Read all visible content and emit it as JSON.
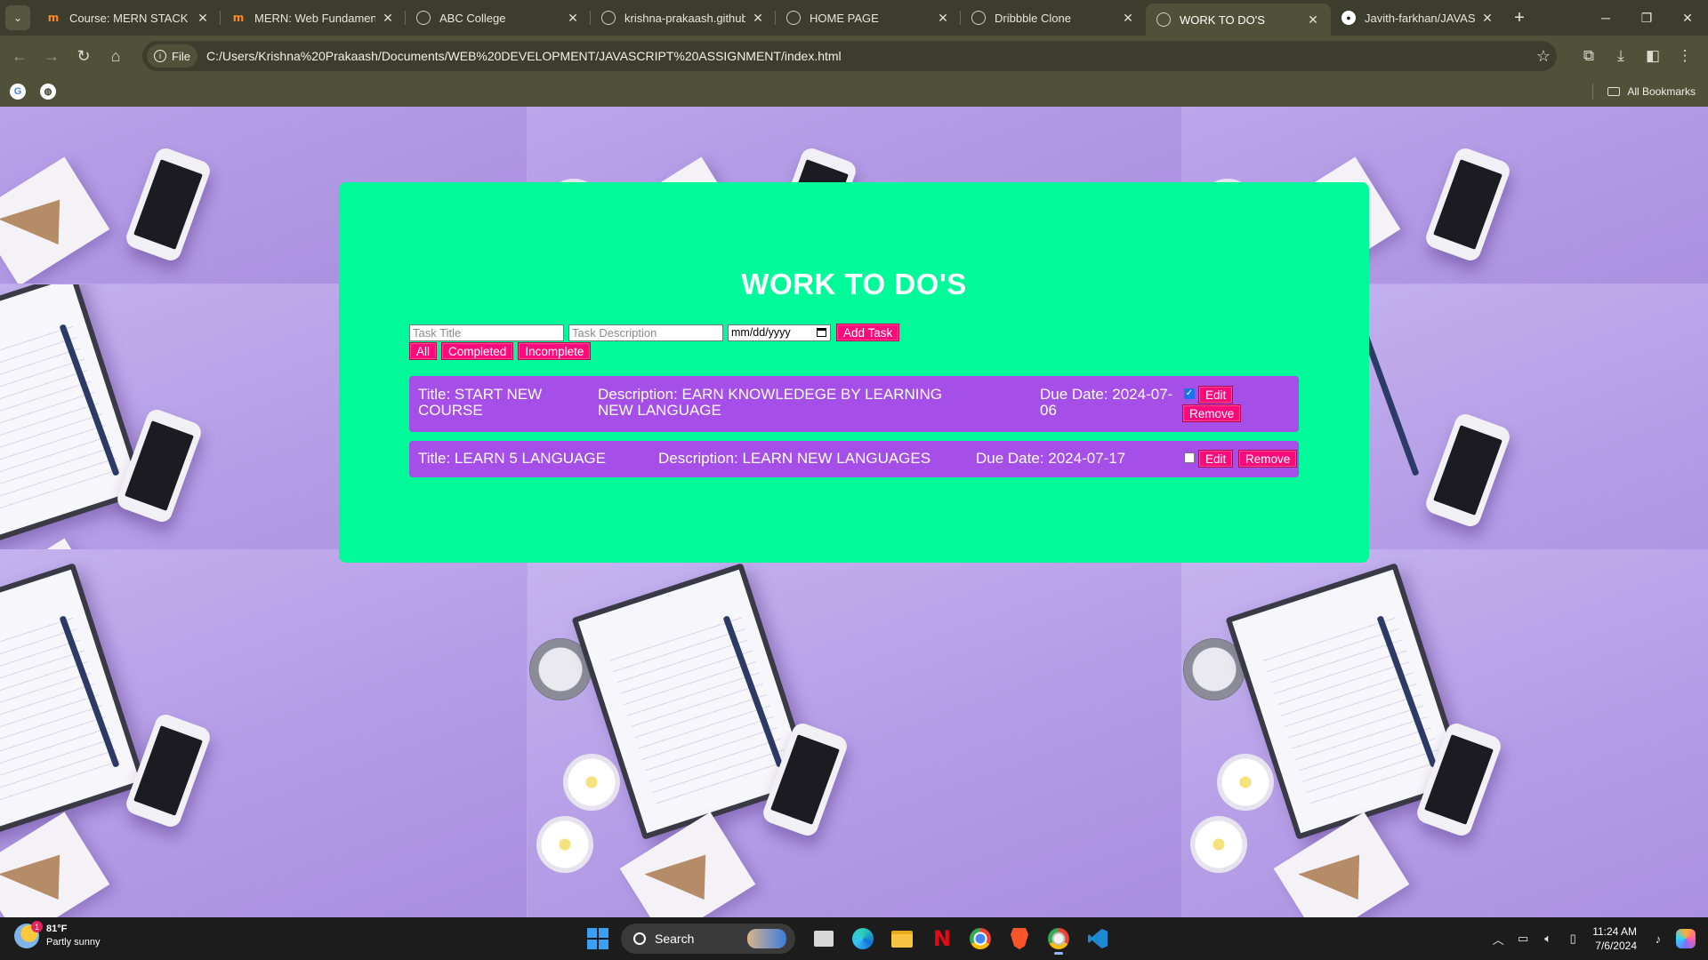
{
  "browser": {
    "tabs": [
      {
        "label": "Course: MERN STACK | SE",
        "favicon": "m-logo-icon",
        "active": false
      },
      {
        "label": "MERN: Web Fundamentals",
        "favicon": "m-logo-icon",
        "active": false
      },
      {
        "label": "ABC College",
        "favicon": "globe-icon",
        "active": false
      },
      {
        "label": "krishna-prakaash.github.io",
        "favicon": "globe-icon",
        "active": false
      },
      {
        "label": "HOME PAGE",
        "favicon": "globe-icon",
        "active": false
      },
      {
        "label": "Dribbble Clone",
        "favicon": "globe-icon",
        "active": false
      },
      {
        "label": "WORK TO DO'S",
        "favicon": "globe-icon",
        "active": true
      },
      {
        "label": "Javith-farkhan/JAVASCRIPT",
        "favicon": "github-icon",
        "active": false
      }
    ],
    "new_tab_label": "+",
    "address": {
      "scheme_chip": "File",
      "url": "C:/Users/Krishna%20Prakaash/Documents/WEB%20DEVELOPMENT/JAVASCRIPT%20ASSIGNMENT/index.html"
    },
    "bookmarks": {
      "all_bookmarks_label": "All Bookmarks"
    }
  },
  "app": {
    "title": "WORK TO DO'S",
    "form": {
      "title_placeholder": "Task Title",
      "description_placeholder": "Task Description",
      "date_placeholder": "mm/dd/yyyy",
      "add_button": "Add Task"
    },
    "filters": {
      "all": "All",
      "completed": "Completed",
      "incomplete": "Incomplete"
    },
    "tasks": [
      {
        "title": "Title: START NEW COURSE",
        "description": "Description: EARN KNOWLEDEGE BY LEARNING NEW LANGUAGE",
        "due": "Due Date: 2024-07-06",
        "completed": true,
        "edit_label": "Edit",
        "remove_label": "Remove"
      },
      {
        "title": "Title: LEARN 5 LANGUAGE",
        "description": "Description: LEARN NEW LANGUAGES",
        "due": "Due Date: 2024-07-17",
        "completed": false,
        "edit_label": "Edit",
        "remove_label": "Remove"
      }
    ],
    "colors": {
      "card": "#00fa9a",
      "task_row": "#a64ee8",
      "button": "#ff0a7a",
      "background": "#bba6ea"
    }
  },
  "taskbar": {
    "weather": {
      "badge": "1",
      "temp": "81°F",
      "condition": "Partly sunny"
    },
    "search_label": "Search",
    "clock": {
      "time": "11:24 AM",
      "date": "7/6/2024"
    }
  }
}
